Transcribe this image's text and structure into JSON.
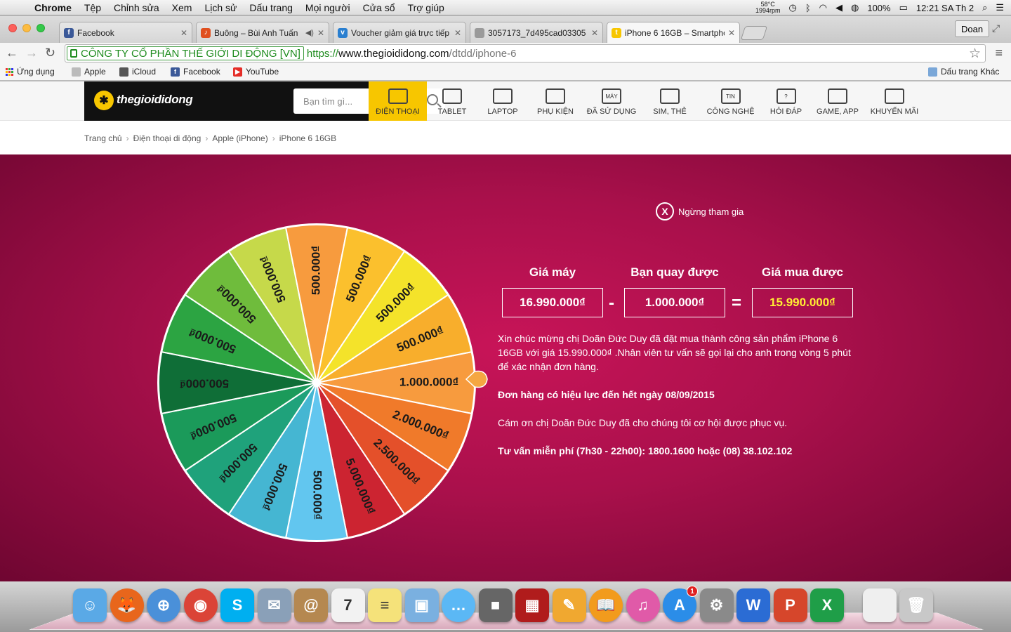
{
  "menubar": {
    "app_name": "Chrome",
    "items": [
      "Tệp",
      "Chỉnh sửa",
      "Xem",
      "Lịch sử",
      "Dấu trang",
      "Mọi người",
      "Cửa sổ",
      "Trợ giúp"
    ],
    "temp_line1": "58°C",
    "temp_line2": "1994rpm",
    "battery": "100%",
    "clock": "12:21 SA Th 2"
  },
  "tabs": [
    {
      "title": "Facebook",
      "icon": "facebook-icon",
      "color": "#3b5998",
      "glyph": "f"
    },
    {
      "title": "Buông – Bùi Anh Tuấn",
      "icon": "music-site-icon",
      "color": "#e05020",
      "glyph": "♪"
    },
    {
      "title": "Voucher giảm giá trực tiếp",
      "icon": "voucher-site-icon",
      "color": "#2a7fd0",
      "glyph": "v"
    },
    {
      "title": "3057173_7d495cad03305",
      "icon": "document-icon",
      "color": "#9a9a9a",
      "glyph": ""
    },
    {
      "title": "iPhone 6 16GB – Smartpho",
      "icon": "thegioididong-icon",
      "color": "#f7c600",
      "glyph": "t"
    }
  ],
  "profile_name": "Doan",
  "address": {
    "ev_name": "CÔNG TY CỔ PHẦN THẾ GIỚI DI ĐỘNG [VN]",
    "scheme": "https://",
    "host": "www.thegioididong.com",
    "path": "/dtdd/iphone-6"
  },
  "bookmarks": {
    "apps": "Ứng dụng",
    "items": [
      {
        "label": "Apple",
        "icon": "page-icon",
        "color": "#bbb",
        "glyph": ""
      },
      {
        "label": "iCloud",
        "icon": "apple-icon",
        "color": "#555",
        "glyph": ""
      },
      {
        "label": "Facebook",
        "icon": "facebook-icon",
        "color": "#3b5998",
        "glyph": "f"
      },
      {
        "label": "YouTube",
        "icon": "youtube-icon",
        "color": "#e52d27",
        "glyph": "▶"
      }
    ],
    "other": "Dấu trang Khác"
  },
  "site": {
    "logo_text": "thegioididong",
    "search_placeholder": "Bạn tìm gì...",
    "nav": [
      {
        "label": "ĐIỆN THOẠI",
        "icon": "phone-icon",
        "glyph": ""
      },
      {
        "label": "TABLET",
        "icon": "tablet-icon",
        "glyph": ""
      },
      {
        "label": "LAPTOP",
        "icon": "laptop-icon",
        "glyph": ""
      },
      {
        "label": "PHỤ KIỆN",
        "icon": "headphones-icon",
        "glyph": ""
      },
      {
        "label": "ĐÃ SỬ DỤNG",
        "icon": "used-device-icon",
        "glyph": "MÁY"
      },
      {
        "label": "SIM, THẺ",
        "icon": "sim-card-icon",
        "glyph": ""
      },
      {
        "label": "CÔNG NGHỆ",
        "icon": "tech-news-icon",
        "glyph": "TIN"
      },
      {
        "label": "HỎI ĐÁP",
        "icon": "question-icon",
        "glyph": "?"
      },
      {
        "label": "GAME, APP",
        "icon": "gamepad-icon",
        "glyph": ""
      },
      {
        "label": "KHUYẾN MÃI",
        "icon": "gift-icon",
        "glyph": ""
      }
    ],
    "breadcrumb": [
      "Trang chủ",
      "Điện thoại di động",
      "Apple (iPhone)",
      "iPhone 6 16GB"
    ]
  },
  "promo": {
    "stop_label": "Ngừng tham gia",
    "stop_x": "X",
    "labels": {
      "price": "Giá máy",
      "won": "Bạn quay được",
      "final": "Giá mua được"
    },
    "values": {
      "price": "16.990.000₫",
      "won": "1.000.000₫",
      "final": "15.990.000₫"
    },
    "minus": "-",
    "equals": "=",
    "message1": "Xin chúc mừng chị Doãn Đức Duy đã đặt mua thành công sản phẩm iPhone 6 16GB với giá 15.990.000₫ .Nhân viên tư vấn sẽ gọi lại cho anh trong vòng 5 phút để xác nhận đơn hàng.",
    "message2": "Đơn hàng có hiệu lực đến hết ngày 08/09/2015",
    "message3": "Cám ơn chị Doãn Đức Duy đã cho chúng tôi cơ hội được phục vụ.",
    "message4": "Tư vấn miễn phí (7h30 - 22h00): 1800.1600 hoặc (08) 38.102.102",
    "wheel_segments": [
      {
        "label": "1.000.000₫",
        "color": "#f79b3e"
      },
      {
        "label": "2.000.000₫",
        "color": "#f07a2a"
      },
      {
        "label": "2.500.000₫",
        "color": "#e4502a"
      },
      {
        "label": "5.000.000₫",
        "color": "#cc2431"
      },
      {
        "label": "500.000₫",
        "color": "#62c6ef"
      },
      {
        "label": "500.000₫",
        "color": "#45b6d2"
      },
      {
        "label": "500.000₫",
        "color": "#1fa27b"
      },
      {
        "label": "500.000₫",
        "color": "#1b9a5a"
      },
      {
        "label": "500.000₫",
        "color": "#0f6e37"
      },
      {
        "label": "500.000₫",
        "color": "#2ca442"
      },
      {
        "label": "500.000₫",
        "color": "#6fbc3c"
      },
      {
        "label": "500.000₫",
        "color": "#c6d94a"
      },
      {
        "label": "500.000₫",
        "color": "#f79b3e"
      },
      {
        "label": "500.000₫",
        "color": "#fbc02d"
      },
      {
        "label": "500.000₫",
        "color": "#f4e32a"
      },
      {
        "label": "500.000₫",
        "color": "#f8ae2c"
      }
    ]
  },
  "dock": [
    {
      "name": "finder-icon",
      "color": "#5aa9e6",
      "glyph": "☺",
      "badge": ""
    },
    {
      "name": "firefox-icon",
      "color": "#e8661c",
      "glyph": "🦊",
      "badge": ""
    },
    {
      "name": "safari-icon",
      "color": "#4a90d9",
      "glyph": "⊕",
      "badge": ""
    },
    {
      "name": "chrome-icon",
      "color": "#db4437",
      "glyph": "◉",
      "badge": ""
    },
    {
      "name": "skype-icon",
      "color": "#00aff0",
      "glyph": "S",
      "badge": ""
    },
    {
      "name": "mail-stamp-icon",
      "color": "#8aa0b8",
      "glyph": "✉",
      "badge": ""
    },
    {
      "name": "contacts-icon",
      "color": "#b58850",
      "glyph": "@",
      "badge": ""
    },
    {
      "name": "calendar-icon",
      "color": "#f2f2f2",
      "glyph": "7",
      "badge": ""
    },
    {
      "name": "notes-icon",
      "color": "#f5e27a",
      "glyph": "≡",
      "badge": ""
    },
    {
      "name": "preview-icon",
      "color": "#7ab0e0",
      "glyph": "▣",
      "badge": ""
    },
    {
      "name": "messages-icon",
      "color": "#5bb8f5",
      "glyph": "…",
      "badge": ""
    },
    {
      "name": "facetime-icon",
      "color": "#666",
      "glyph": "■",
      "badge": ""
    },
    {
      "name": "photo-booth-icon",
      "color": "#b01c1c",
      "glyph": "▦",
      "badge": ""
    },
    {
      "name": "pages-icon",
      "color": "#f0a830",
      "glyph": "✎",
      "badge": ""
    },
    {
      "name": "ibooks-icon",
      "color": "#f29b1d",
      "glyph": "📖",
      "badge": ""
    },
    {
      "name": "itunes-icon",
      "color": "#e05aa8",
      "glyph": "♫",
      "badge": ""
    },
    {
      "name": "app-store-icon",
      "color": "#2b8de8",
      "glyph": "A",
      "badge": "1"
    },
    {
      "name": "system-preferences-icon",
      "color": "#8a8a8a",
      "glyph": "⚙",
      "badge": ""
    },
    {
      "name": "word-icon",
      "color": "#2b6cd4",
      "glyph": "W",
      "badge": ""
    },
    {
      "name": "powerpoint-icon",
      "color": "#d6462b",
      "glyph": "P",
      "badge": ""
    },
    {
      "name": "excel-icon",
      "color": "#1f9e48",
      "glyph": "X",
      "badge": ""
    },
    {
      "name": "document-stack-icon",
      "color": "#efefef",
      "glyph": "",
      "badge": ""
    },
    {
      "name": "trash-icon",
      "color": "#c8c8c8",
      "glyph": "🗑",
      "badge": ""
    }
  ]
}
